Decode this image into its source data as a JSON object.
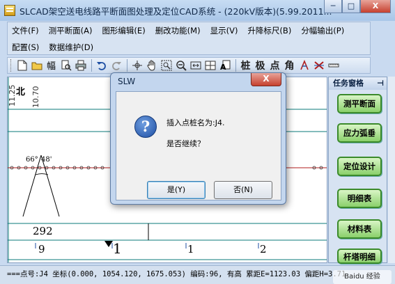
{
  "window": {
    "title": "SLCAD架空送电线路平断面图处理及定位CAD系统 - (220kV版本)(5.99.2011..."
  },
  "caption": {
    "min": "─",
    "max": "□",
    "close": "X"
  },
  "menu": {
    "row1": [
      "文件(F)",
      "测平断面(A)",
      "图形编辑(E)",
      "删改功能(M)",
      "显示(V)",
      "升降标尺(B)",
      "分幅输出(P)"
    ],
    "row2": [
      "配置(S)",
      "数据维护(D)"
    ]
  },
  "toolbar": {
    "text_tools": [
      "桩",
      "极",
      "点",
      "角"
    ]
  },
  "canvas": {
    "north_label": "北",
    "vertical_labels": [
      "11.25",
      "10.70"
    ],
    "angle_labels": [
      "66°",
      "48'"
    ],
    "value_292": "292",
    "axis_labels": [
      "9",
      "1",
      "1",
      "2"
    ]
  },
  "taskpane": {
    "title": "任务窗格",
    "pin": "⊣",
    "buttons": [
      "测平断面",
      "应力弧垂",
      "定位设计",
      "明细表",
      "材料表",
      "杆塔明细"
    ]
  },
  "status": {
    "text": "===点号:J4 坐标(0.000, 1054.120, 1675.053) 编码:96, 有高 累距E=1123.03 偏距H=3.71"
  },
  "dialog": {
    "title": "SLW",
    "close": "X",
    "icon": "?",
    "message_line1": "插入点桩名为:J4.",
    "message_line2": "是否继续？",
    "yes_label": "是(Y)",
    "no_label": "否(N)"
  },
  "watermark": {
    "text": "Baidu 经验"
  },
  "colors": {
    "accent": "#3b8a2a",
    "grid_line": "#0a7a7a",
    "profile_line": "#b01c1c"
  }
}
